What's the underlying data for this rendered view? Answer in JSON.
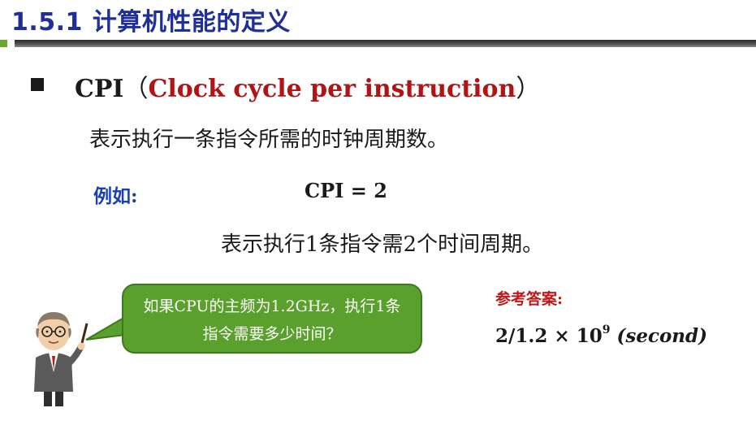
{
  "title": {
    "number": "1.5.1",
    "text": "计算机性能的定义"
  },
  "cpi": {
    "term": "CPI",
    "open_paren": "（",
    "english": "Clock cycle per instruction",
    "close_paren": "）",
    "description": "表示执行一条指令所需的时钟周期数。"
  },
  "example": {
    "label": "例如:",
    "formula": "CPI = 2",
    "explanation": "表示执行1条指令需2个时间周期。"
  },
  "speech_bubble": {
    "line1": "如果CPU的主频为1.2GHz，执行1条",
    "line2": "指令需要多少时间？"
  },
  "answer": {
    "label": "参考答案:",
    "base": "2/1.2 × 10",
    "exponent": "9",
    "unit": "(second)"
  },
  "colors": {
    "title": "#1f2f9a",
    "english_term": "#b01414",
    "example_label": "#1a3fb0",
    "answer_label": "#c01818",
    "bubble": "#5aa02c",
    "accent_bar": "#6aa82f"
  }
}
